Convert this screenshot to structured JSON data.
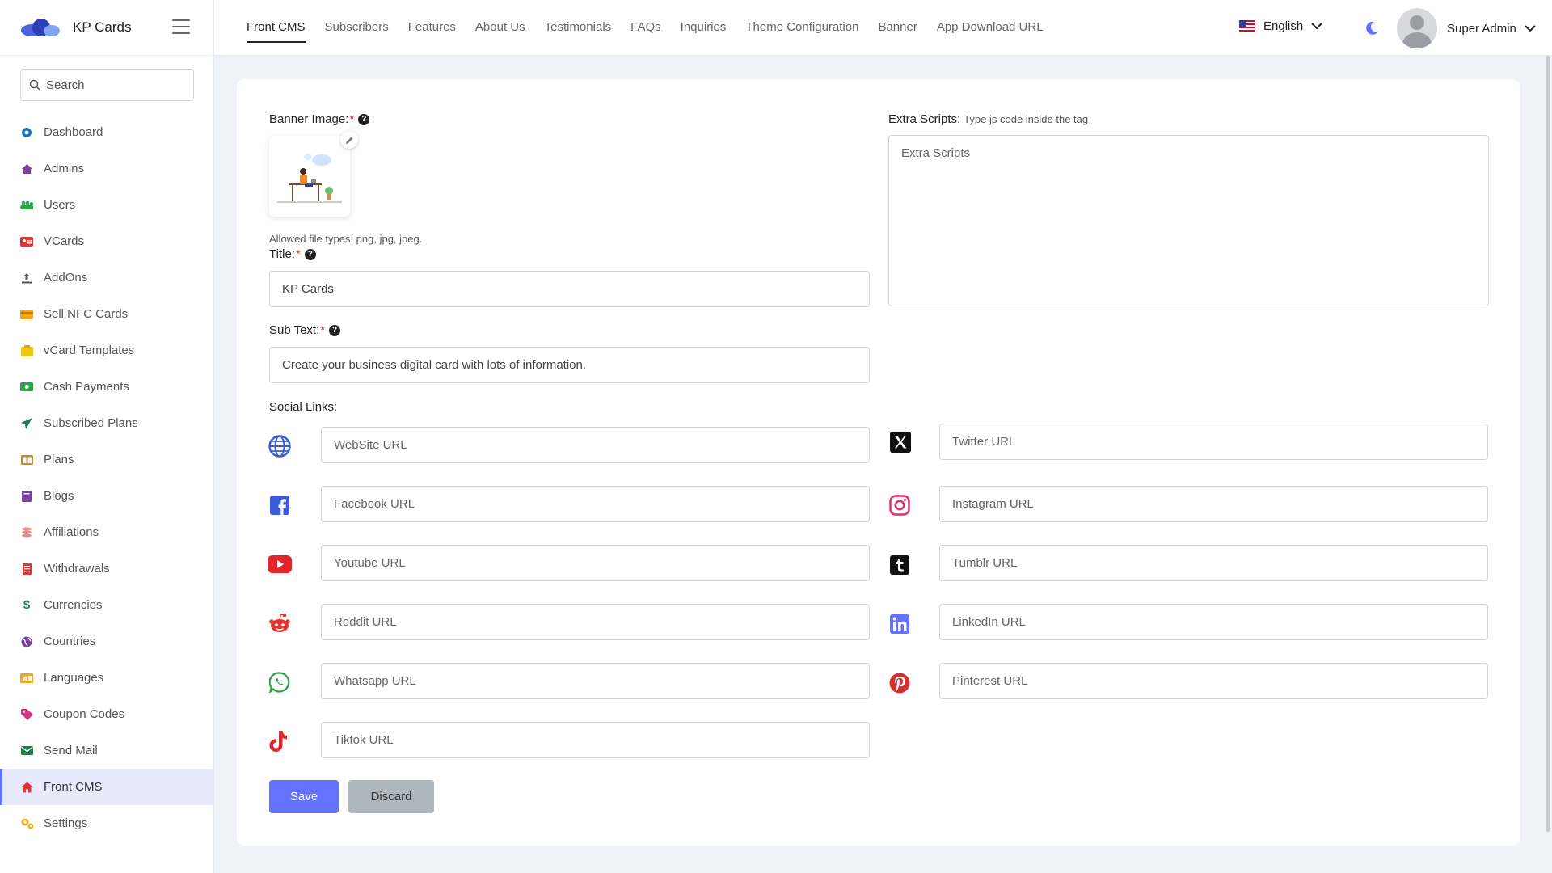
{
  "brand": {
    "name": "KP Cards"
  },
  "sidebar": {
    "search_placeholder": "Search",
    "items": [
      {
        "label": "Dashboard",
        "icon": "dashboard-icon",
        "color": "#1e73be"
      },
      {
        "label": "Admins",
        "icon": "admin-icon",
        "color": "#7b3fa1"
      },
      {
        "label": "Users",
        "icon": "users-icon",
        "color": "#28a745"
      },
      {
        "label": "VCards",
        "icon": "vcard-icon",
        "color": "#e3342f"
      },
      {
        "label": "AddOns",
        "icon": "upload-icon",
        "color": "#555555"
      },
      {
        "label": "Sell NFC Cards",
        "icon": "credit-card-icon",
        "color": "#f5a623"
      },
      {
        "label": "vCard Templates",
        "icon": "template-icon",
        "color": "#f0c419"
      },
      {
        "label": "Cash Payments",
        "icon": "cash-icon",
        "color": "#28a745"
      },
      {
        "label": "Subscribed Plans",
        "icon": "paper-plane-icon",
        "color": "#1f7a4d"
      },
      {
        "label": "Plans",
        "icon": "plans-icon",
        "color": "#c78a2e"
      },
      {
        "label": "Blogs",
        "icon": "book-icon",
        "color": "#7b3fa1"
      },
      {
        "label": "Affiliations",
        "icon": "coins-icon",
        "color": "#e88a8a"
      },
      {
        "label": "Withdrawals",
        "icon": "receipt-icon",
        "color": "#e3342f"
      },
      {
        "label": "Currencies",
        "icon": "dollar-icon",
        "color": "#1f7a4d"
      },
      {
        "label": "Countries",
        "icon": "globe-icon",
        "color": "#7b3fa1"
      },
      {
        "label": "Languages",
        "icon": "language-icon",
        "color": "#f5a623"
      },
      {
        "label": "Coupon Codes",
        "icon": "tag-icon",
        "color": "#d63384"
      },
      {
        "label": "Send Mail",
        "icon": "mail-icon",
        "color": "#1f7a4d"
      },
      {
        "label": "Front CMS",
        "icon": "home-icon",
        "color": "#e3342f"
      },
      {
        "label": "Settings",
        "icon": "gears-icon",
        "color": "#f5a623"
      }
    ]
  },
  "header": {
    "tabs": [
      "Front CMS",
      "Subscribers",
      "Features",
      "About Us",
      "Testimonials",
      "FAQs",
      "Inquiries",
      "Theme Configuration",
      "Banner",
      "App Download URL"
    ],
    "language": "English",
    "user_name": "Super Admin"
  },
  "form": {
    "banner_label": "Banner Image:",
    "allowed_types": "Allowed file types: png, jpg, jpeg.",
    "title_label": "Title:",
    "title_value": "KP Cards",
    "subtext_label": "Sub Text:",
    "subtext_value": "Create your business digital card with lots of information.",
    "extra_scripts_label": "Extra Scripts:",
    "extra_scripts_hint": "Type js code inside the tag",
    "extra_scripts_placeholder": "Extra Scripts",
    "social_label": "Social Links:",
    "required_mark": "*",
    "help_mark": "?",
    "social_left": [
      {
        "placeholder": "WebSite URL",
        "icon": "globe-icon"
      },
      {
        "placeholder": "Facebook URL",
        "icon": "facebook-icon"
      },
      {
        "placeholder": "Youtube URL",
        "icon": "youtube-icon"
      },
      {
        "placeholder": "Reddit URL",
        "icon": "reddit-icon"
      },
      {
        "placeholder": "Whatsapp URL",
        "icon": "whatsapp-icon"
      },
      {
        "placeholder": "Tiktok URL",
        "icon": "tiktok-icon"
      }
    ],
    "social_right": [
      {
        "placeholder": "Twitter URL",
        "icon": "x-twitter-icon"
      },
      {
        "placeholder": "Instagram URL",
        "icon": "instagram-icon"
      },
      {
        "placeholder": "Tumblr URL",
        "icon": "tumblr-icon"
      },
      {
        "placeholder": "LinkedIn URL",
        "icon": "linkedin-icon"
      },
      {
        "placeholder": "Pinterest URL",
        "icon": "pinterest-icon"
      }
    ],
    "save_label": "Save",
    "discard_label": "Discard"
  },
  "colors": {
    "accent": "#6571ff",
    "required": "#e3342f"
  }
}
